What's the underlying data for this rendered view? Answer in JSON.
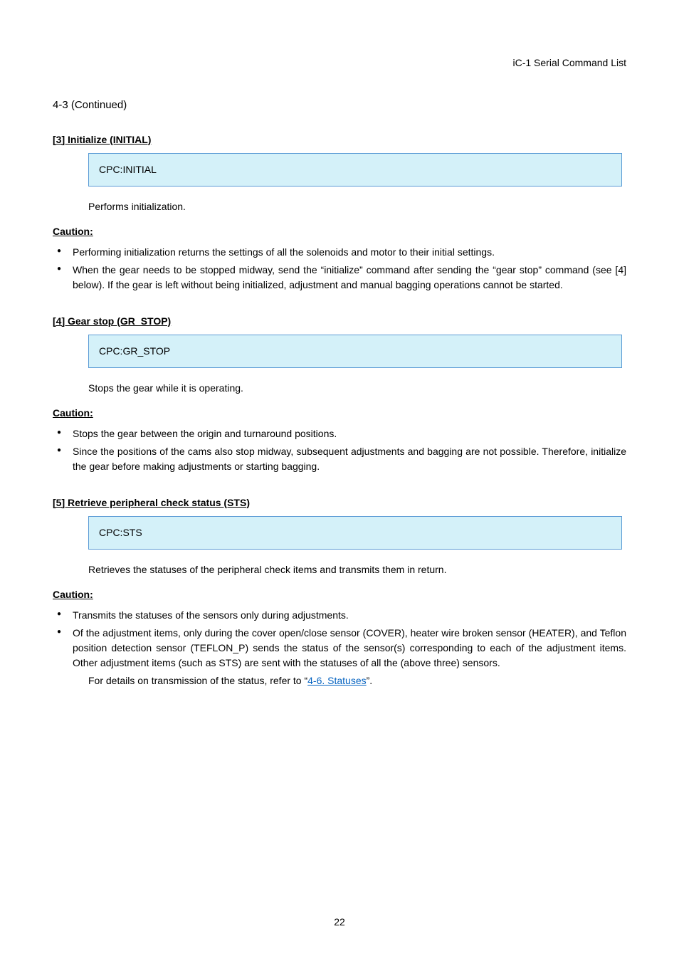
{
  "doc_title": "iC-1 Serial Command List",
  "section_chain": "4-3 (Continued)",
  "commands": [
    {
      "heading": "[3] Initialize (INITIAL)",
      "box": "CPC:INITIAL",
      "desc": "Performs initialization.",
      "caution_heading": "Caution:",
      "bullets": [
        "Performing initialization returns the settings of all the solenoids and motor to their initial settings.",
        "When the gear needs to be stopped midway, send the “initialize” command after sending the “gear stop” command (see [4] below). If the gear is left without being initialized, adjustment and manual bagging operations cannot be started."
      ]
    },
    {
      "heading": "[4] Gear stop (GR_STOP)",
      "box": "CPC:GR_STOP",
      "desc": "Stops the gear while it is operating.",
      "caution_heading": "Caution:",
      "bullets": [
        "Stops the gear between the origin and turnaround positions.",
        "Since the positions of the cams also stop midway, subsequent adjustments and bagging are not possible. Therefore, initialize the gear before making adjustments or starting bagging."
      ]
    },
    {
      "heading": "[5] Retrieve peripheral check status (STS)",
      "box": "CPC:STS",
      "desc": "Retrieves the statuses of the peripheral check items and transmits them in return.",
      "caution_heading": "Caution:",
      "bullets": [
        "Transmits the statuses of the sensors only during adjustments.",
        "Of the adjustment items, only during the cover open/close sensor (COVER), heater wire broken sensor (HEATER), and Teflon position detection sensor (TEFLON_P) sends the status of the sensor(s) corresponding to each of the adjustment items. Other adjustment items (such as STS) are sent with the statuses of all the (above three) sensors.",
        "For details on transmission of the status, refer to “4-6. Statuses”."
      ],
      "special_link_text": "4-6. Statuses",
      "special_wrap_prefix": "For details on transmission of the status, refer to “",
      "special_wrap_suffix": "”."
    }
  ],
  "page_number": "22"
}
